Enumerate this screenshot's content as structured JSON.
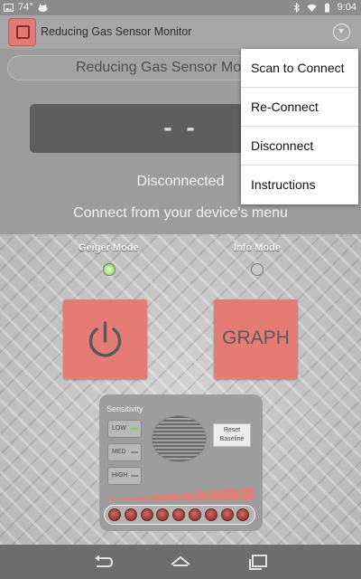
{
  "status_bar": {
    "battery_level": "74°",
    "time": "9:04"
  },
  "action_bar": {
    "app_title": "Reducing Gas Sensor Monitor"
  },
  "panel": {
    "title": "Reducing Gas Sensor Monitor",
    "reading": "- -",
    "status": "Disconnected",
    "hint": "Connect from your device's menu"
  },
  "menu": {
    "items": [
      "Scan to Connect",
      "Re-Connect",
      "Disconnect",
      "Instructions"
    ]
  },
  "modes": {
    "geiger_label": "Geiger Mode",
    "info_label": "Info Mode",
    "geiger_active": true,
    "info_active": false
  },
  "buttons": {
    "graph_label": "GRAPH"
  },
  "sensitivity": {
    "title": "Sensitivity",
    "levels": [
      "LOW",
      "MED",
      "HIGH"
    ],
    "active_level": "LOW",
    "reset_label_line1": "Reset",
    "reset_label_line2": "Baseline",
    "meter_levels": [
      1,
      2,
      3,
      4,
      5,
      6,
      7,
      8,
      9,
      10
    ],
    "led_count": 9
  },
  "colors": {
    "accent": "#e57b75",
    "led_on": "#7fd04a"
  },
  "icons": {
    "power": "power-icon",
    "back": "back-icon",
    "home": "home-icon",
    "recents": "recents-icon"
  }
}
